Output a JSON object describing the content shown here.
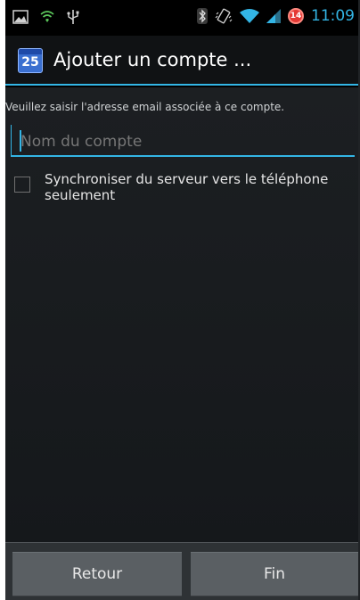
{
  "status_bar": {
    "time": "11:09",
    "notification_count": "14",
    "icons": [
      "picture-icon",
      "wifi-hotspot-icon",
      "usb-icon",
      "bluetooth-icon",
      "vibrate-icon",
      "wifi-signal-icon",
      "cellular-signal-icon"
    ]
  },
  "action_bar": {
    "icon_number": "25",
    "title": "Ajouter un compte ..."
  },
  "form": {
    "instruction": "Veuillez saisir l'adresse email associée à ce compte.",
    "account_name_placeholder": "Nom du compte",
    "account_name_value": "",
    "sync_checkbox_label": "Synchroniser du serveur vers le téléphone seulement",
    "sync_checked": false
  },
  "buttons": {
    "back_label": "Retour",
    "done_label": "Fin"
  },
  "colors": {
    "accent": "#33b5e5",
    "background": "#1c1f22",
    "button": "#5a5f63"
  }
}
